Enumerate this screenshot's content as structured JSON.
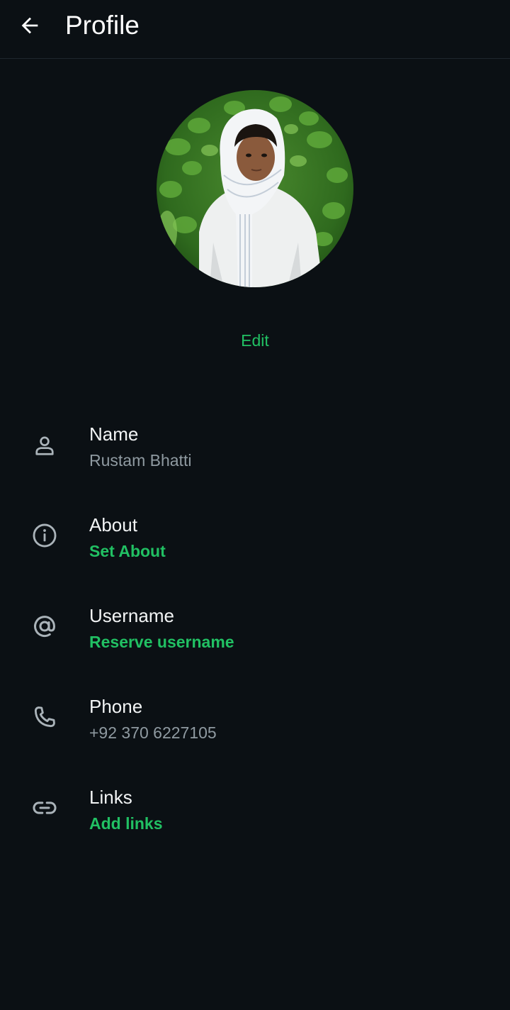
{
  "header": {
    "title": "Profile",
    "back_icon": "arrow-left-icon"
  },
  "avatar": {
    "edit_label": "Edit"
  },
  "colors": {
    "background": "#0b1014",
    "accent": "#21c063",
    "secondary_text": "#8f9aa1",
    "icon": "#aab3b9"
  },
  "rows": [
    {
      "icon": "person-icon",
      "label": "Name",
      "value": "Rustam Bhatti"
    },
    {
      "icon": "info-icon",
      "label": "About",
      "value": "Set About"
    },
    {
      "icon": "at-sign-icon",
      "label": "Username",
      "value": "Reserve username"
    },
    {
      "icon": "phone-icon",
      "label": "Phone",
      "value": "+92 370 6227105"
    },
    {
      "icon": "link-icon",
      "label": "Links",
      "value": "Add links"
    }
  ]
}
